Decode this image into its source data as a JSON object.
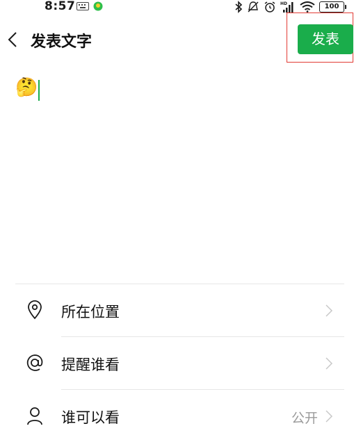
{
  "status_bar": {
    "time": "8:57",
    "battery": "100"
  },
  "header": {
    "title": "发表文字",
    "publish_label": "发表"
  },
  "composer": {
    "text": "🤔"
  },
  "options": [
    {
      "icon": "location-icon",
      "label": "所在位置"
    },
    {
      "icon": "at-icon",
      "label": "提醒谁看"
    },
    {
      "icon": "person-icon",
      "label": "谁可以看",
      "value": "公开"
    }
  ],
  "colors": {
    "accent": "#1aad4b",
    "highlight_border": "#e23b34"
  }
}
